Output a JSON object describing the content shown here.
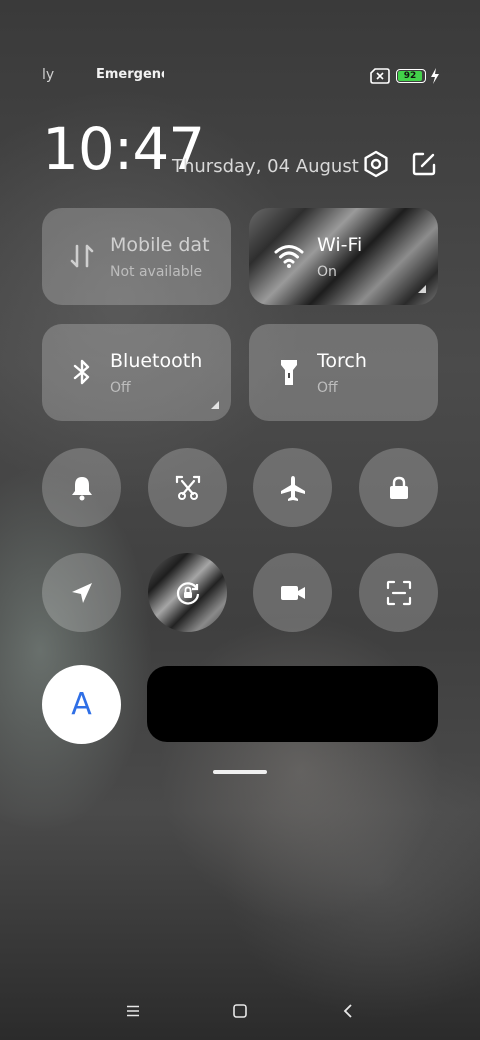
{
  "status_bar": {
    "carrier_1": "ly",
    "carrier_2": "Emergency",
    "sim_icon": "sim-missing-icon",
    "battery_level": "92",
    "battery_fraction": 0.92,
    "charging_icon": "bolt-icon",
    "battery_color": "#43d14a"
  },
  "header": {
    "time": "10:47",
    "date": "Thursday, 04 August",
    "settings_icon": "settings-icon",
    "edit_icon": "edit-icon"
  },
  "tiles": [
    {
      "id": "mobile-data",
      "title": "Mobile data",
      "subtitle": "Not available",
      "icon": "mobile-data-icon",
      "active": false
    },
    {
      "id": "wifi",
      "title": "Wi-Fi",
      "subtitle": "On",
      "icon": "wifi-icon",
      "active": true
    },
    {
      "id": "bluetooth",
      "title": "Bluetooth",
      "subtitle": "Off",
      "icon": "bluetooth-icon",
      "active": false
    },
    {
      "id": "torch",
      "title": "Torch",
      "subtitle": "Off",
      "icon": "torch-icon",
      "active": false
    }
  ],
  "toggles_row1": [
    {
      "id": "sound",
      "icon": "bell-icon",
      "active": false
    },
    {
      "id": "screenshot",
      "icon": "scissors-screenshot-icon",
      "active": false
    },
    {
      "id": "airplane",
      "icon": "airplane-icon",
      "active": false
    },
    {
      "id": "lock",
      "icon": "lock-icon",
      "active": false
    }
  ],
  "toggles_row2": [
    {
      "id": "location",
      "icon": "location-arrow-icon",
      "active": false
    },
    {
      "id": "rotation-lock",
      "icon": "rotation-lock-icon",
      "active": true
    },
    {
      "id": "screen-record",
      "icon": "video-camera-icon",
      "active": false
    },
    {
      "id": "scanner",
      "icon": "scan-icon",
      "active": false
    }
  ],
  "auto_brightness": {
    "letter": "A",
    "color": "#2f6fe6"
  },
  "navigation": {
    "menu_icon": "menu-icon",
    "home_icon": "home-square-icon",
    "back_icon": "back-chevron-icon"
  }
}
